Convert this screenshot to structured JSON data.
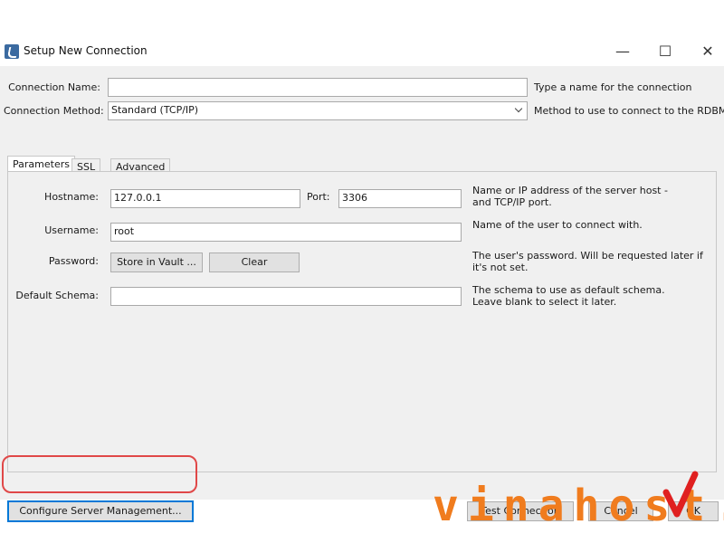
{
  "window": {
    "title": "Setup New Connection",
    "controls": {
      "minimize": "—",
      "maximize": "☐",
      "close": "✕"
    }
  },
  "form": {
    "connection_name": {
      "label": "Connection Name:",
      "value": "",
      "help": "Type a name for the connection"
    },
    "connection_method": {
      "label": "Connection Method:",
      "value": "Standard (TCP/IP)",
      "help": "Method to use to connect to the RDBMS"
    }
  },
  "tabs": [
    {
      "label": "Parameters",
      "active": true
    },
    {
      "label": "SSL",
      "active": false
    },
    {
      "label": "Advanced",
      "active": false
    }
  ],
  "parameters": {
    "hostname": {
      "label": "Hostname:",
      "value": "127.0.0.1",
      "help": "Name or IP address of the server host - and TCP/IP port."
    },
    "port": {
      "label": "Port:",
      "value": "3306"
    },
    "username": {
      "label": "Username:",
      "value": "root",
      "help": "Name of the user to connect with."
    },
    "password": {
      "label": "Password:",
      "store_button": "Store in Vault ...",
      "clear_button": "Clear",
      "help": "The user's password. Will be requested later if it's not set."
    },
    "default_schema": {
      "label": "Default Schema:",
      "value": "",
      "help": "The schema to use as default schema. Leave blank to select it later."
    }
  },
  "footer": {
    "configure_button": "Configure Server Management...",
    "test_button": "Test Connection",
    "cancel_button": "Cancel",
    "ok_button": "OK"
  },
  "watermark": {
    "text": "vinahost",
    "dot": ".",
    "color": "#f07c1e",
    "mark_color": "#e02020"
  },
  "colors": {
    "callout": "#e04848",
    "focus": "#0078d7"
  }
}
